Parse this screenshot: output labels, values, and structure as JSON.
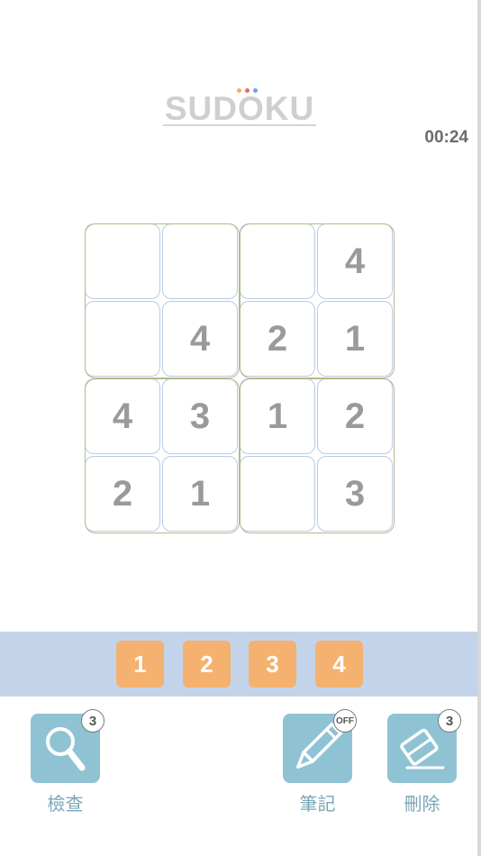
{
  "header": {
    "logo_text": "SUDOKU",
    "logo_dot_colors": [
      "#f2b25e",
      "#e46a6a",
      "#6aa6e4"
    ],
    "timer": "00:24"
  },
  "board": {
    "cells": [
      [
        "",
        "",
        "",
        "4"
      ],
      [
        "",
        "4",
        "2",
        "1"
      ],
      [
        "4",
        "3",
        "1",
        "2"
      ],
      [
        "2",
        "1",
        "",
        "3"
      ]
    ]
  },
  "number_bar": {
    "numbers": [
      "1",
      "2",
      "3",
      "4"
    ]
  },
  "tools": {
    "check": {
      "label": "檢查",
      "badge": "3",
      "icon": "magnifier-icon"
    },
    "notes": {
      "label": "筆記",
      "badge": "OFF",
      "icon": "pencil-icon"
    },
    "erase": {
      "label": "刪除",
      "badge": "3",
      "icon": "eraser-icon"
    }
  },
  "colors": {
    "number_button": "#f4b16f",
    "number_bar": "#c3d4ea",
    "tool_tile": "#8fc3d4",
    "cell_border": "#b9cbe6",
    "box_border": "#b7b98a"
  }
}
